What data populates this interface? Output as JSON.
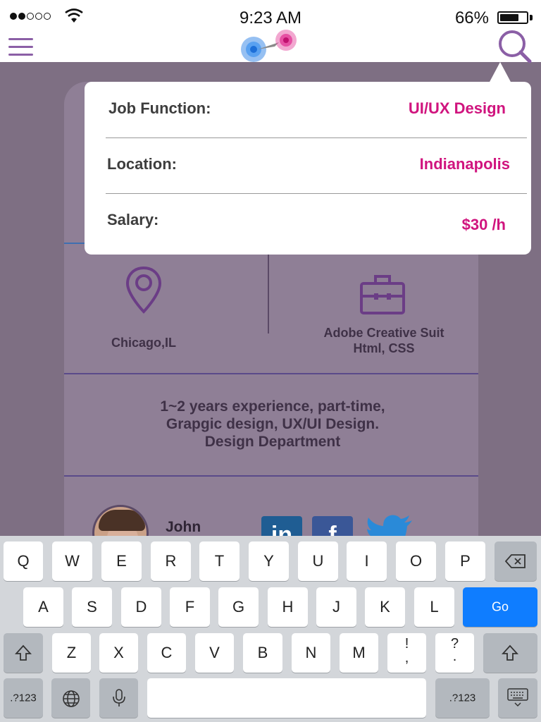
{
  "status_bar": {
    "time": "9:23 AM",
    "battery_percent": "66%",
    "signal_bars": 2,
    "signal_total": 5
  },
  "nav": {
    "menu_icon": "hamburger-icon",
    "logo_icon": "app-logo-icon",
    "search_icon": "search-icon"
  },
  "filter_popover": {
    "rows": [
      {
        "label": "Job Function:",
        "value": "UI/UX Design"
      },
      {
        "label": "Location:",
        "value": "Indianapolis"
      },
      {
        "label": "Salary:",
        "value": "$30 /h"
      }
    ]
  },
  "job_card": {
    "location": "Chicago,IL",
    "skills_line1": "Adobe Creative Suit",
    "skills_line2": "Html, CSS",
    "experience_line1": "1~2 years experience, part-time,",
    "experience_line2": "Grapgic design, UX/UI Design.",
    "experience_line3": "Design Department",
    "contact_name": "John",
    "social": {
      "linkedin": "in",
      "facebook": "f"
    }
  },
  "keyboard": {
    "row1": [
      "Q",
      "W",
      "E",
      "R",
      "T",
      "Y",
      "U",
      "I",
      "O",
      "P"
    ],
    "row2": [
      "A",
      "S",
      "D",
      "F",
      "G",
      "H",
      "J",
      "K",
      "L"
    ],
    "row3": [
      "Z",
      "X",
      "C",
      "V",
      "B",
      "N",
      "M"
    ],
    "punct1_top": "!",
    "punct1_bottom": ",",
    "punct2_top": "?",
    "punct2_bottom": ".",
    "go_label": "Go",
    "numbers_label": ".?123"
  },
  "colors": {
    "accent": "#d0147e",
    "brand_purple": "#8b5fa6",
    "go_blue": "#0f7dff",
    "overlay": "#7e6f83"
  }
}
